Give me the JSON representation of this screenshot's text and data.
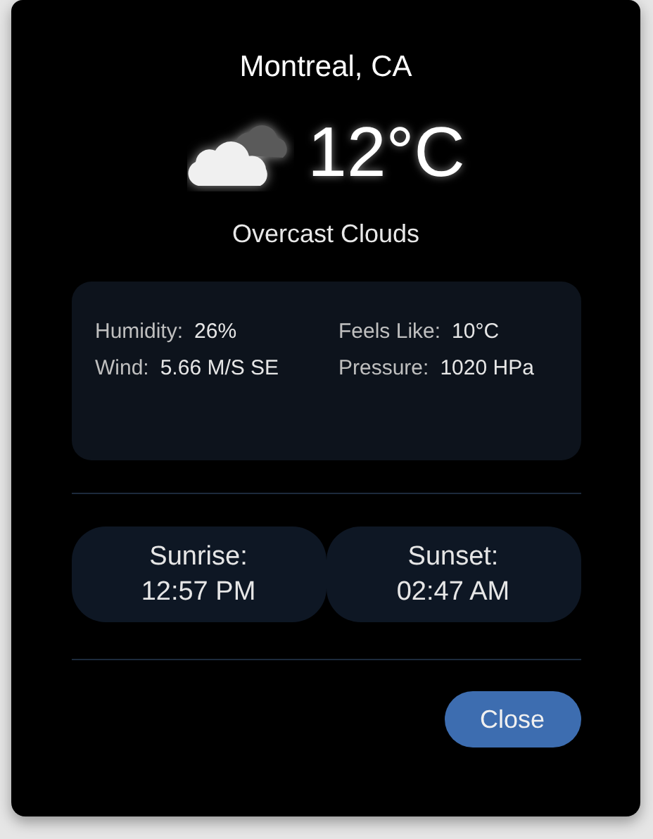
{
  "location": "Montreal, CA",
  "temperature": "12°C",
  "description": "Overcast Clouds",
  "stats": [
    {
      "label": "Humidity:",
      "value": "26%"
    },
    {
      "label": "Feels Like:",
      "value": "10°C"
    },
    {
      "label": "Wind:",
      "value": "5.66 M/S SE"
    },
    {
      "label": "Pressure:",
      "value": "1020 HPa"
    }
  ],
  "sun": [
    {
      "label": "Sunrise:",
      "time": "12:57 PM"
    },
    {
      "label": "Sunset:",
      "time": "02:47 AM"
    }
  ],
  "buttons": [
    "Close"
  ]
}
